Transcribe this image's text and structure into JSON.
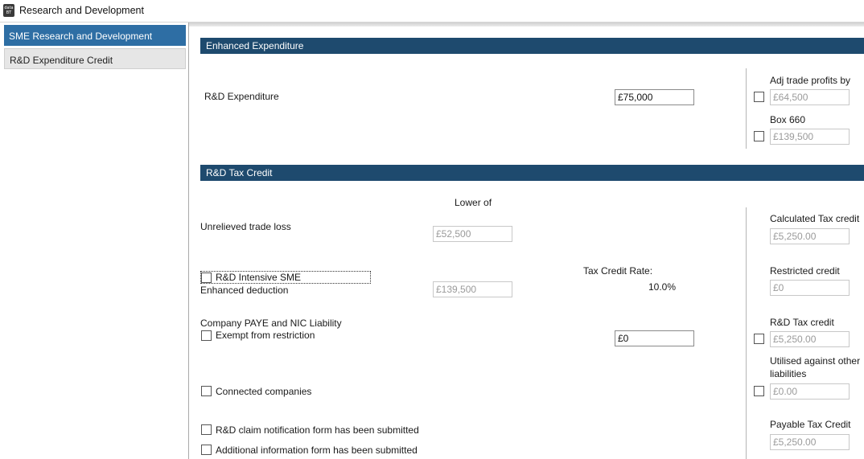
{
  "window": {
    "title": "Research and Development",
    "icon_text": "data BT"
  },
  "sidebar": {
    "items": [
      {
        "label": "SME Research and Development",
        "active": true
      },
      {
        "label": "R&D Expenditure Credit",
        "active": false
      }
    ]
  },
  "enhanced": {
    "header": "Enhanced Expenditure",
    "rd_expenditure_label": "R&D Expenditure",
    "rd_expenditure_value": "£75,000",
    "adj_trade_label": "Adj trade profits by",
    "adj_trade_value": "£64,500",
    "box660_label": "Box 660",
    "box660_value": "£139,500"
  },
  "taxcredit": {
    "header": "R&D Tax Credit",
    "lower_of": "Lower of",
    "unrelieved_label": "Unrelieved trade loss",
    "unrelieved_value": "£52,500",
    "intensive_label": "R&D Intensive SME",
    "enhanced_deduction_label": "Enhanced deduction",
    "enhanced_deduction_value": "£139,500",
    "rate_label": "Tax Credit Rate:",
    "rate_value": "10.0%",
    "paye_label": "Company PAYE and NIC Liability",
    "exempt_label": "Exempt from restriction",
    "paye_value": "£0",
    "connected_label": "Connected companies",
    "notification_label": "R&D claim notification form has been submitted",
    "additional_label": "Additional information form has been submitted",
    "calculated_label": "Calculated Tax credit",
    "calculated_value": "£5,250.00",
    "restricted_label": "Restricted credit",
    "restricted_value": "£0",
    "rd_credit_label": "R&D Tax credit",
    "rd_credit_value": "£5,250.00",
    "utilised_label_1": "Utilised against other",
    "utilised_label_2": "liabilities",
    "utilised_value": "£0.00",
    "payable_label": "Payable Tax Credit",
    "payable_value": "£5,250.00"
  }
}
